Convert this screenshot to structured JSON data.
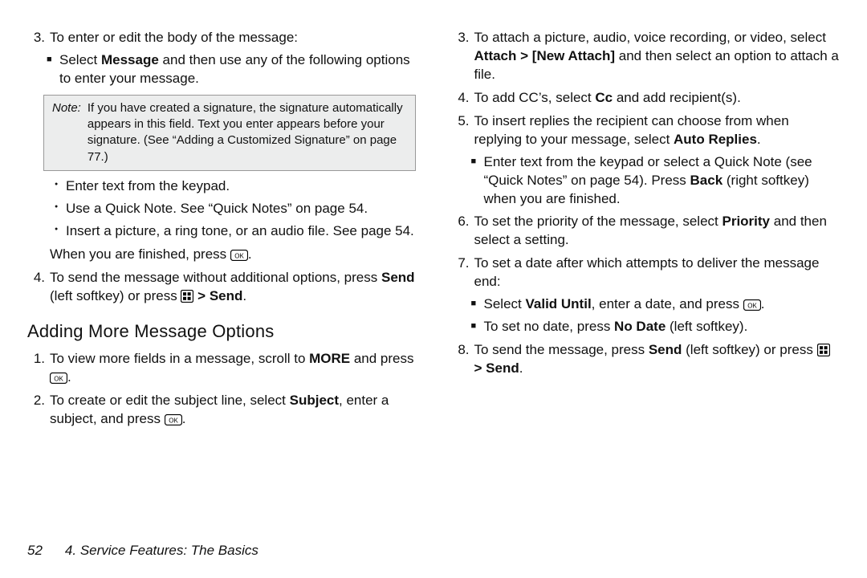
{
  "left": {
    "item3_lead": "To enter or edit the body of the message:",
    "item3_sub1_pre": "Select ",
    "item3_sub1_bold": "Message",
    "item3_sub1_post": " and then use any of the following options to enter your message.",
    "note_label": "Note:",
    "note_body": "If you have created a signature, the signature automatically appears in this field. Text you enter appears before your signature. (See “Adding a Customized Signature” on page 77.)",
    "bullet_a": "Enter text from the keypad.",
    "bullet_b": "Use a Quick Note. See “Quick Notes” on page 54.",
    "bullet_c": "Insert a picture, a ring tone, or an audio file. See page 54.",
    "finished_pre": "When you are finished, press ",
    "finished_post": ".",
    "item4_pre": "To send the message without additional options, press ",
    "item4_b1": "Send",
    "item4_mid": " (left softkey) or press ",
    "item4_gt": " > ",
    "item4_b2": "Send",
    "item4_post": ".",
    "heading": "Adding More Message Options",
    "a_item1_pre": "To view more fields in a message, scroll to ",
    "a_item1_bold": "MORE",
    "a_item1_mid": " and press ",
    "a_item1_post": ".",
    "a_item2_pre": "To create or edit the subject line, select ",
    "a_item2_bold": "Subject",
    "a_item2_mid": ", enter a subject, and press ",
    "a_item2_post": "."
  },
  "right": {
    "item3_pre": "To attach a picture, audio, voice recording, or video, select ",
    "item3_b1": "Attach > ",
    "item3_b2": "[New Attach]",
    "item3_post": " and then select an option to attach a file.",
    "item4_pre": "To add CC’s, select ",
    "item4_b": "Cc",
    "item4_post": " and add recipient(s).",
    "item5_pre": "To insert replies the recipient can choose from when replying to your message, select ",
    "item5_b": "Auto Replies",
    "item5_post": ".",
    "item5_sub_pre": "Enter text from the keypad or select a Quick Note (see “Quick Notes” on page 54). Press ",
    "item5_sub_b": "Back",
    "item5_sub_post": " (right softkey) when you are finished.",
    "item6_pre": "To set the priority of the message, select ",
    "item6_b": "Priority",
    "item6_post": " and then select a setting.",
    "item7_lead": "To set a date after which attempts to deliver the message end:",
    "item7_s1_pre": "Select ",
    "item7_s1_b": "Valid Until",
    "item7_s1_mid": ", enter a date, and press ",
    "item7_s1_post": ".",
    "item7_s2_pre": "To set no date, press ",
    "item7_s2_b": "No Date",
    "item7_s2_post": " (left softkey).",
    "item8_pre": "To send the message, press ",
    "item8_b1": "Send",
    "item8_mid": " (left softkey) or press ",
    "item8_gt": " > ",
    "item8_b2": "Send",
    "item8_post": "."
  },
  "footer": {
    "page": "52",
    "chapter": "4. Service Features: The Basics"
  }
}
